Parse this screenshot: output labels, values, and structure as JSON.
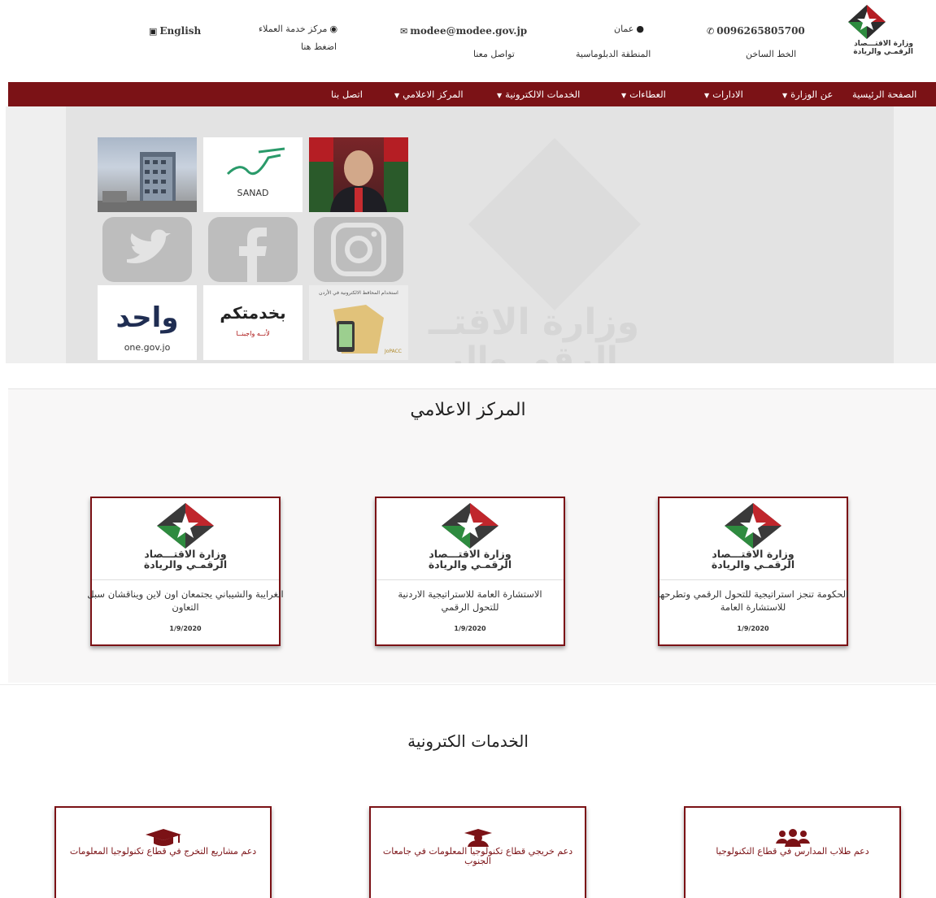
{
  "topbar": {
    "language_label": "English",
    "service_center_label": "مركز خدمة العملاء",
    "service_center_link": "اضغط هنا",
    "email": "modee@modee.gov.jp",
    "contact_label": "تواصل معنا",
    "city": "عمان",
    "zone": "المنطقة الدبلوماسية",
    "phone": "0096265805700",
    "hotline_label": "الخط الساخن",
    "logo_text_line1": "وزارة الاقتـــصاد",
    "logo_text_line2": "الرقمـي والريادة"
  },
  "nav": {
    "items": [
      {
        "label": "الصفحة الرئيسية",
        "has_caret": false
      },
      {
        "label": "عن الوزارة",
        "has_caret": true
      },
      {
        "label": "الادارات",
        "has_caret": true
      },
      {
        "label": "العطاءات",
        "has_caret": true
      },
      {
        "label": "الخدمات الالكترونية",
        "has_caret": true
      },
      {
        "label": "المركز الاعلامي",
        "has_caret": true
      },
      {
        "label": "اتصل بنا",
        "has_caret": false
      }
    ],
    "background": "#7b1216"
  },
  "hero": {
    "watermark_line1": "وزارة الاقتــ",
    "watermark_line2": "الرقمـ والر",
    "tiles": {
      "sanad_label": "SANAD",
      "wahid_label": "واحد",
      "wahid_url": "one.gov.jo",
      "khidma_label": "بخدمتكم",
      "khidma_sub": "لأنــه واجبنــا",
      "app_label": "استخدام المحافظ الالكترونية في الأردن",
      "app_badge": "JoPACC"
    }
  },
  "media": {
    "title": "المركز الاعلامي",
    "cards": [
      {
        "logo_line1": "وزارة الاقتـــصاد",
        "logo_line2": "الرقمـي والريادة",
        "text": "الغرايبة والشيباني يجتمعان اون لاين ويناقشان سبل التعاون",
        "date": "1/9/2020"
      },
      {
        "logo_line1": "وزارة الاقتـــصاد",
        "logo_line2": "الرقمـي والريادة",
        "text": "الاستشارة العامة للاستراتيجية الاردنية للتحول الرقمي",
        "date": "1/9/2020"
      },
      {
        "logo_line1": "وزارة الاقتـــصاد",
        "logo_line2": "الرقمـي والريادة",
        "text": "الحكومة تنجز استراتيجية للتحول الرقمي وتطرحها للاستشارة العامة",
        "date": "1/9/2020"
      }
    ]
  },
  "services": {
    "title": "الخدمات الكترونية",
    "cards": [
      {
        "icon": "graduation-cap-icon",
        "text": "دعم مشاريع التخرج في قطاع تكنولوجيا المعلومات"
      },
      {
        "icon": "graduate-user-icon",
        "text": "دعم خريجي قطاع تكنولوجيا المعلومات في جامعات الجنوب"
      },
      {
        "icon": "users-icon",
        "text": "دعم طلاب المدارس في قطاع التكنولوجيا"
      }
    ]
  }
}
